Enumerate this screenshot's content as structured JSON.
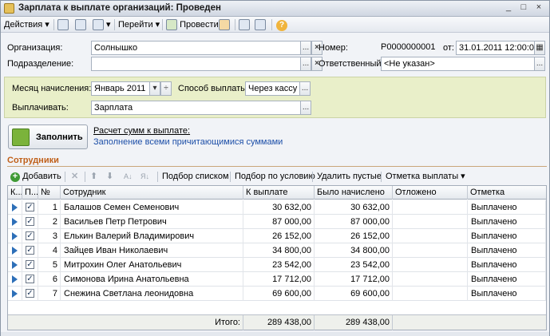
{
  "window": {
    "title": "Зарплата к выплате организаций: Проведен",
    "controls": [
      "_",
      "□",
      "×"
    ]
  },
  "toolbar": {
    "actions_label": "Действия",
    "goto_label": "Перейти",
    "post_label": "Провести",
    "help_label": "?"
  },
  "header": {
    "org_label": "Организация:",
    "org_value": "Солнышко",
    "number_label": "Номер:",
    "number_value": "P0000000001",
    "date_label": "от:",
    "date_value": "31.01.2011 12:00:00",
    "dept_label": "Подразделение:",
    "dept_value": "",
    "responsible_label": "Ответственный:",
    "responsible_value": "<Не указан>"
  },
  "panel": {
    "month_label": "Месяц начисления:",
    "month_value": "Январь 2011",
    "method_label": "Способ выплаты:",
    "method_value": "Через кассу",
    "pay_label": "Выплачивать:",
    "pay_value": "Зарплата"
  },
  "fill": {
    "button_label": "Заполнить",
    "calc_link": "Расчет сумм к выплате:",
    "calc_desc": "Заполнение всеми причитающимися суммами"
  },
  "section": {
    "title": "Сотрудники"
  },
  "grid_toolbar": {
    "add_label": "Добавить",
    "pick_list": "Подбор списком",
    "pick_cond": "Подбор по условию",
    "delete_empty": "Удалить пустые",
    "mark_payment": "Отметка выплаты"
  },
  "grid": {
    "columns": [
      "К...",
      "П...",
      "№",
      "Сотрудник",
      "К выплате",
      "Было начислено",
      "Отложено",
      "Отметка"
    ],
    "rows": [
      {
        "n": "1",
        "name": "Балашов Семен Семенович",
        "pay": "30 632,00",
        "accrued": "30 632,00",
        "deferred": "",
        "mark": "Выплачено",
        "checked": "✓"
      },
      {
        "n": "2",
        "name": "Васильев Петр Петрович",
        "pay": "87 000,00",
        "accrued": "87 000,00",
        "deferred": "",
        "mark": "Выплачено",
        "checked": "✓"
      },
      {
        "n": "3",
        "name": "Елькин Валерий Владимирович",
        "pay": "26 152,00",
        "accrued": "26 152,00",
        "deferred": "",
        "mark": "Выплачено",
        "checked": "✓"
      },
      {
        "n": "4",
        "name": "Зайцев Иван Николаевич",
        "pay": "34 800,00",
        "accrued": "34 800,00",
        "deferred": "",
        "mark": "Выплачено",
        "checked": "✓"
      },
      {
        "n": "5",
        "name": "Митрохин Олег Анатольевич",
        "pay": "23 542,00",
        "accrued": "23 542,00",
        "deferred": "",
        "mark": "Выплачено",
        "checked": "✓"
      },
      {
        "n": "6",
        "name": "Симонова Ирина Анатольевна",
        "pay": "17 712,00",
        "accrued": "17 712,00",
        "deferred": "",
        "mark": "Выплачено",
        "checked": "✓"
      },
      {
        "n": "7",
        "name": "Снежина Светлана леонидовна",
        "pay": "69 600,00",
        "accrued": "69 600,00",
        "deferred": "",
        "mark": "Выплачено",
        "checked": "✓"
      }
    ],
    "total_label": "Итого:",
    "total_pay": "289 438,00",
    "total_accrued": "289 438,00"
  }
}
